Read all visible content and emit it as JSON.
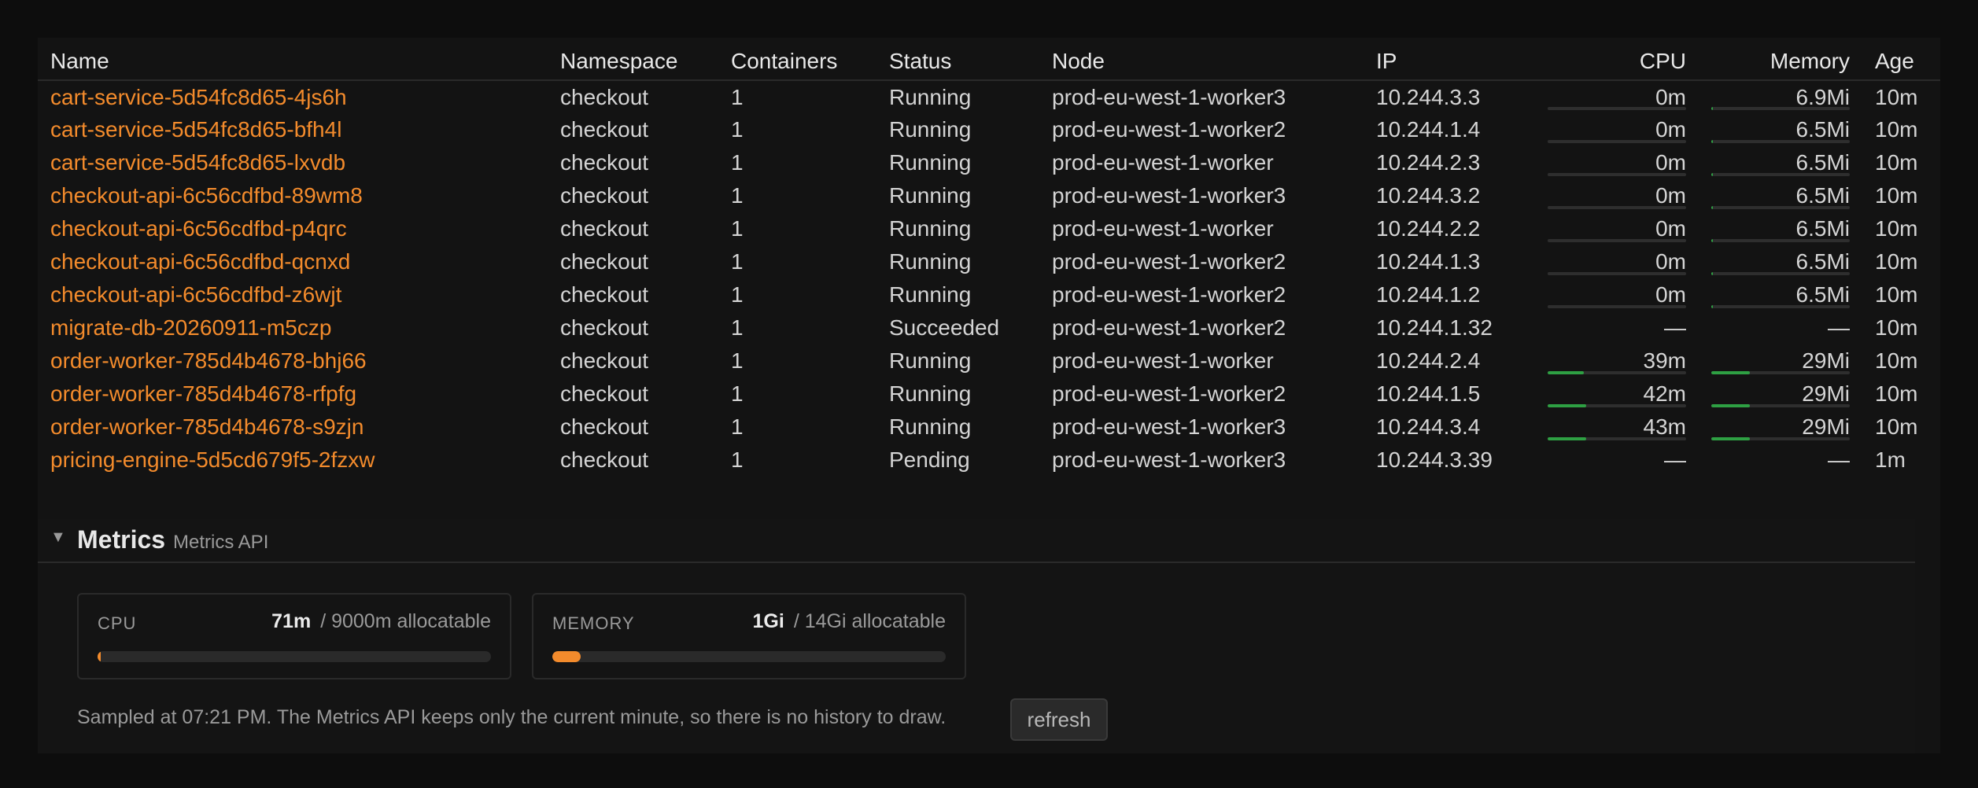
{
  "columns": {
    "name": "Name",
    "namespace": "Namespace",
    "containers": "Containers",
    "status": "Status",
    "node": "Node",
    "ip": "IP",
    "cpu": "CPU",
    "memory": "Memory",
    "age": "Age"
  },
  "pods": [
    {
      "name": "cart-service-5d54fc8d65-4js6h",
      "namespace": "checkout",
      "containers": "1",
      "status": "Running",
      "node": "prod-eu-west-1-worker3",
      "ip": "10.244.3.3",
      "cpu": "0m",
      "cpu_pct": 0,
      "memory": "6.9Mi",
      "mem_pct": 1,
      "age": "10m"
    },
    {
      "name": "cart-service-5d54fc8d65-bfh4l",
      "namespace": "checkout",
      "containers": "1",
      "status": "Running",
      "node": "prod-eu-west-1-worker2",
      "ip": "10.244.1.4",
      "cpu": "0m",
      "cpu_pct": 0,
      "memory": "6.5Mi",
      "mem_pct": 1,
      "age": "10m"
    },
    {
      "name": "cart-service-5d54fc8d65-lxvdb",
      "namespace": "checkout",
      "containers": "1",
      "status": "Running",
      "node": "prod-eu-west-1-worker",
      "ip": "10.244.2.3",
      "cpu": "0m",
      "cpu_pct": 0,
      "memory": "6.5Mi",
      "mem_pct": 1,
      "age": "10m"
    },
    {
      "name": "checkout-api-6c56cdfbd-89wm8",
      "namespace": "checkout",
      "containers": "1",
      "status": "Running",
      "node": "prod-eu-west-1-worker3",
      "ip": "10.244.3.2",
      "cpu": "0m",
      "cpu_pct": 0,
      "memory": "6.5Mi",
      "mem_pct": 1,
      "age": "10m"
    },
    {
      "name": "checkout-api-6c56cdfbd-p4qrc",
      "namespace": "checkout",
      "containers": "1",
      "status": "Running",
      "node": "prod-eu-west-1-worker",
      "ip": "10.244.2.2",
      "cpu": "0m",
      "cpu_pct": 0,
      "memory": "6.5Mi",
      "mem_pct": 1,
      "age": "10m"
    },
    {
      "name": "checkout-api-6c56cdfbd-qcnxd",
      "namespace": "checkout",
      "containers": "1",
      "status": "Running",
      "node": "prod-eu-west-1-worker2",
      "ip": "10.244.1.3",
      "cpu": "0m",
      "cpu_pct": 0,
      "memory": "6.5Mi",
      "mem_pct": 1,
      "age": "10m"
    },
    {
      "name": "checkout-api-6c56cdfbd-z6wjt",
      "namespace": "checkout",
      "containers": "1",
      "status": "Running",
      "node": "prod-eu-west-1-worker2",
      "ip": "10.244.1.2",
      "cpu": "0m",
      "cpu_pct": 0,
      "memory": "6.5Mi",
      "mem_pct": 1,
      "age": "10m"
    },
    {
      "name": "migrate-db-20260911-m5czp",
      "namespace": "checkout",
      "containers": "1",
      "status": "Succeeded",
      "node": "prod-eu-west-1-worker2",
      "ip": "10.244.1.32",
      "cpu": "—",
      "cpu_pct": null,
      "memory": "—",
      "mem_pct": null,
      "age": "10m"
    },
    {
      "name": "order-worker-785d4b4678-bhj66",
      "namespace": "checkout",
      "containers": "1",
      "status": "Running",
      "node": "prod-eu-west-1-worker",
      "ip": "10.244.2.4",
      "cpu": "39m",
      "cpu_pct": 26,
      "memory": "29Mi",
      "mem_pct": 28,
      "age": "10m"
    },
    {
      "name": "order-worker-785d4b4678-rfpfg",
      "namespace": "checkout",
      "containers": "1",
      "status": "Running",
      "node": "prod-eu-west-1-worker2",
      "ip": "10.244.1.5",
      "cpu": "42m",
      "cpu_pct": 28,
      "memory": "29Mi",
      "mem_pct": 28,
      "age": "10m"
    },
    {
      "name": "order-worker-785d4b4678-s9zjn",
      "namespace": "checkout",
      "containers": "1",
      "status": "Running",
      "node": "prod-eu-west-1-worker3",
      "ip": "10.244.3.4",
      "cpu": "43m",
      "cpu_pct": 28,
      "memory": "29Mi",
      "mem_pct": 28,
      "age": "10m"
    },
    {
      "name": "pricing-engine-5d5cd679f5-2fzxw",
      "namespace": "checkout",
      "containers": "1",
      "status": "Pending",
      "node": "prod-eu-west-1-worker3",
      "ip": "10.244.3.39",
      "cpu": "—",
      "cpu_pct": null,
      "memory": "—",
      "mem_pct": null,
      "age": "1m"
    }
  ],
  "metrics": {
    "caret": "▼",
    "title": "Metrics",
    "subtitle": "Metrics API",
    "cpu": {
      "label": "CPU",
      "value": "71m",
      "allocatable": "/ 9000m allocatable",
      "pct": 0.8
    },
    "memory": {
      "label": "MEMORY",
      "value": "1Gi",
      "allocatable": "/ 14Gi allocatable",
      "pct": 7.1
    },
    "note": "Sampled at 07:21 PM. The Metrics API keeps only the current minute, so there is no history to draw.",
    "refresh_label": "refresh"
  },
  "colors": {
    "accent": "#f38b2c",
    "usage_bar": "#2ea043",
    "background": "#0d0d0d"
  }
}
